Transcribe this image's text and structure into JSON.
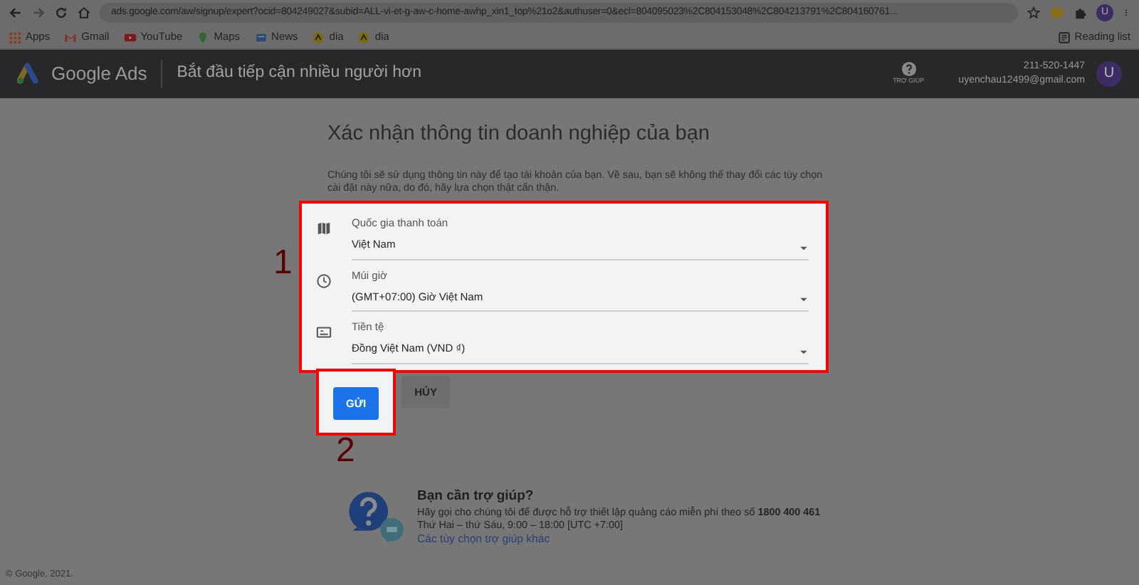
{
  "browser": {
    "url": "ads.google.com/aw/signup/expert?ocid=804249027&subid=ALL-vi-et-g-aw-c-home-awhp_xin1_top%21o2&authuser=0&ecl=804095023%2C804153048%2C804213791%2C804160761...",
    "avatar": "U",
    "reading_list": "Reading list",
    "bookmarks": [
      {
        "label": "Apps",
        "kind": "apps"
      },
      {
        "label": "Gmail",
        "kind": "gmail"
      },
      {
        "label": "YouTube",
        "kind": "youtube"
      },
      {
        "label": "Maps",
        "kind": "maps"
      },
      {
        "label": "News",
        "kind": "news"
      },
      {
        "label": "dia",
        "kind": "dia"
      },
      {
        "label": "dia",
        "kind": "dia"
      }
    ]
  },
  "header": {
    "product": "Google Ads",
    "tagline": "Bắt đầu tiếp cận nhiều người hơn",
    "help_label": "TRỢ GIÚP",
    "phone": "211-520-1447",
    "email": "uyenchau12499@gmail.com",
    "avatar": "U"
  },
  "form": {
    "title": "Xác nhận thông tin doanh nghiệp của bạn",
    "description": "Chúng tôi sẽ sử dụng thông tin này để tạo tài khoản của bạn. Về sau, bạn sẽ không thể thay đổi các tùy chọn cài đặt này nữa, do đó, hãy lựa chọn thật cẩn thận.",
    "fields": [
      {
        "kind": "map",
        "label": "Quốc gia thanh toán",
        "value": "Việt Nam"
      },
      {
        "kind": "clock",
        "label": "Múi giờ",
        "value": "(GMT+07:00) Giờ Việt Nam"
      },
      {
        "kind": "currency",
        "label": "Tiền tệ",
        "value": "Đồng Việt Nam (VND ₫)"
      }
    ],
    "annotation": "1"
  },
  "buttons": [
    {
      "label": "GỬI",
      "kind": "primary",
      "annotation": "2"
    },
    {
      "label": "HỦY",
      "kind": "secondary"
    }
  ],
  "help": {
    "title": "Bạn cần trợ giúp?",
    "line": "Hãy gọi cho chúng tôi để được hỗ trợ thiết lập quảng cáo miễn phí theo số **1800 400 461**",
    "hours": "Thứ Hai – thứ Sáu, 9:00 – 18:00 [UTC +7:00]",
    "link": "Các tùy chọn trợ giúp khác"
  },
  "footer": "© Google, 2021."
}
